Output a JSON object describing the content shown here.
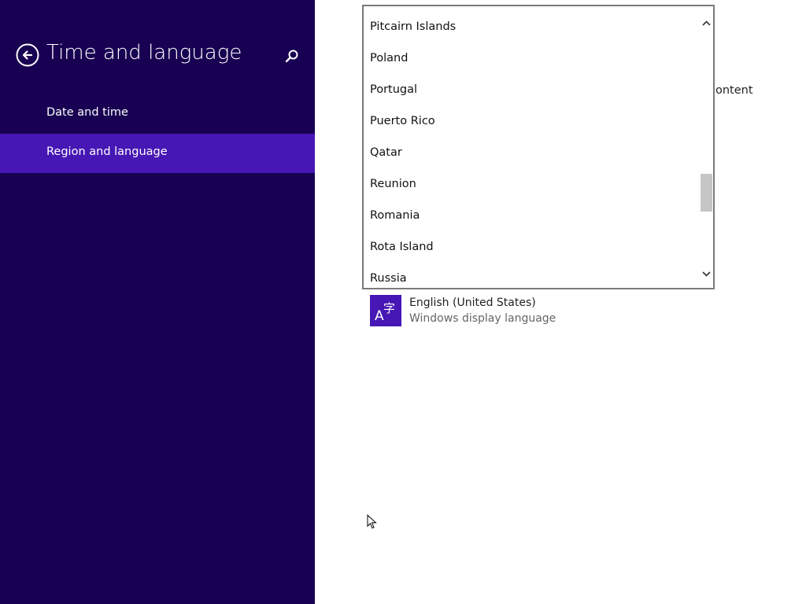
{
  "sidebar": {
    "title": "Time and language",
    "items": [
      {
        "label": "Date and time",
        "selected": false
      },
      {
        "label": "Region and language",
        "selected": true
      }
    ]
  },
  "main": {
    "partial_text": "ontent",
    "dropdown": {
      "options": [
        "Pitcairn Islands",
        "Poland",
        "Portugal",
        "Puerto Rico",
        "Qatar",
        "Reunion",
        "Romania",
        "Rota Island",
        "Russia"
      ]
    },
    "language": {
      "name": "English (United States)",
      "subtitle": "Windows display language",
      "icon_glyph_a": "A",
      "icon_glyph_b": "字"
    }
  },
  "colors": {
    "sidebar_bg": "#180052",
    "selected_bg": "#4617b4",
    "accent": "#4617b4"
  },
  "icons": [
    "back-arrow-icon",
    "search-icon",
    "chevron-up-icon",
    "chevron-down-icon",
    "language-icon",
    "mouse-cursor-icon"
  ]
}
